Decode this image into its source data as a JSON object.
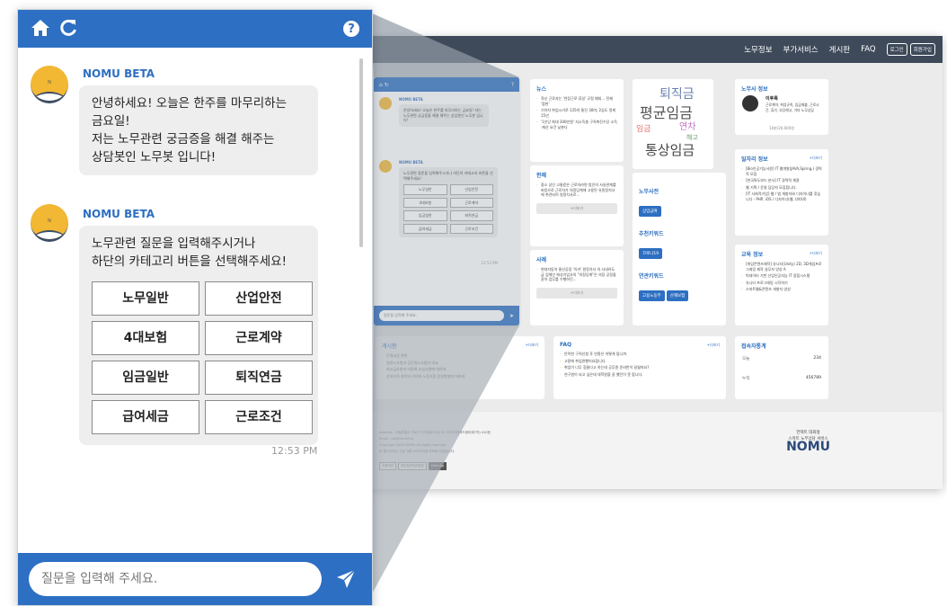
{
  "site": {
    "nav": [
      "노무정보",
      "부가서비스",
      "게시판",
      "FAQ"
    ],
    "login_btn": "로그인",
    "signup_btn": "회원가입",
    "news": {
      "title": "뉴스",
      "items": [
        "육신 근로자는 '연장근로·휴일' 규정 예외... 전제 '합헌'",
        "기아차 취업시기로 135억 통진 30여, 2심도 정계 15년",
        "'1인당 최대 300만원' 지소득층 구직촉진수당 소득·재산 요건 낮춘다"
      ]
    },
    "cases": {
      "title": "판례",
      "items": [
        "중소 상인 고통받은 근로자라면 법인의 사실관계를 바탕으로 근로자가 의정당계에 고용된 유원정치사에 취견되어 원정치사로..."
      ],
      "more": "+더보기"
    },
    "examples": {
      "title": "사례",
      "items": [
        "현대자동차 울산공장 '이카' 원정치서 의 사내하도급 업체인 애성기업사의 \"의정당계\"은 의장 공정을 같아 업무를 수행하던..."
      ],
      "more": "+더보기"
    },
    "wordcloud": [
      "퇴직금",
      "평균임금",
      "통상임금",
      "연차",
      "임금",
      "해고"
    ],
    "dictionary": {
      "title": "노무사전",
      "tag": "상임금여",
      "keywords_title": "추천키워드",
      "keyword": "코로나19",
      "related_title": "연관키워드",
      "related": [
        "고용노동부",
        "산재보험"
      ]
    },
    "profile": {
      "title": "노무사 정보",
      "name": "이후록",
      "desc": "근로계약, 취업규칙, 임금체불, 근로시간, 휴가, 부당해고, 기타 노무상담",
      "fee": "10분/20,000원"
    },
    "jobs": {
      "title": "일자리 정보",
      "more": "+더보기",
      "items": [
        "[Bio인공기능사원] IT 웹개발(JAVA,Spring,) 경력직 모집",
        "[한국특도보드 분사] IT 경력직 채용",
        "웹 기획 / 운영 담당자 모집합니다.",
        "[IT 사회적기업] 웹 / 앱 개발자와 디자이너를 찾습니다 - PHP, iOS / 디자이너(웹, UX/UI)"
      ]
    },
    "edu": {
      "title": "교육 정보",
      "more": "+더보기",
      "items": [
        "[게임콘텐츠제작] 유니티(Unity) 2D, 3D게임프로그래밍 제작 실무자 양성 A",
        "빅데이터 기반 산업인공지능 IT 융합시스템",
        "유니티 프로그래밍 시작하기",
        "스마트웹&콘텐츠 개발자 양성"
      ]
    },
    "board": {
      "title": "게시판",
      "more": "+더보기",
      "items": [
        "단체교섭 관련",
        "일반노조법과 공무원노조법의 비교",
        "비교급사항과 비용화 교섭사항에 대하여",
        "산하조직 설치와 의의와 노동조합 운영방향에 대하여"
      ]
    },
    "faq": {
      "title": "FAQ",
      "more": "+더보기",
      "items": [
        "안락한 구직신청 후 만종은 어떻게 됩니까.",
        "고용에 취업관했어요합니다.",
        "취업이 너무 힘들다고 하는데 공무원 준비반이 달될까요?",
        "연구원이 되고 싶은데 대학원을 갈 했던이 못 합니다."
      ]
    },
    "visitors": {
      "title": "접속자통계",
      "today_label": "오늘",
      "today": "234",
      "total_label": "누적",
      "total": "456789"
    },
    "footer": {
      "lines": [
        "Address : 서울특별시 구로구 디지털로33길 55 (이앤씨벤처드림타워7차) 410호",
        "Email : biz@ctcnet.kr",
        "Copyright 2020 NOMU All rights reserved",
        "본 웹사이트는 구글 크롬 브라우저에 최적화 되었습니다."
      ],
      "btns": [
        "이용약관",
        "개인정보처리방침",
        "Sitemap"
      ],
      "company": "언택트 대화형",
      "service": "스마트 노무상담 서비스",
      "logo": "NOMU"
    }
  },
  "mini_chat": {
    "bot_name": "NOMU BETA",
    "msg1": "안녕하세요! 오늘은 한주를 마무리하는 금요일! 저는 노무관련 궁금증을 해결 해주는 상담봇인 노무봇 입니다!",
    "msg2": "노무관련 질문을 입력해주시거나 하단의 카테고리 버튼을 선택해주세요!",
    "time": "12:53 PM",
    "placeholder": "질문을 입력해 주세요."
  },
  "chat": {
    "bot_name": "NOMU BETA",
    "avatar_letter": "N",
    "msg1_lines": [
      "안녕하세요! 오늘은 한주를 마무리하는",
      "금요일!",
      "저는 노무관련 궁금증을 해결 해주는",
      "상담봇인 노무봇 입니다!"
    ],
    "msg2_lines": [
      "노무관련 질문을 입력해주시거나",
      "하단의 카테고리 버튼을 선택해주세요!"
    ],
    "categories": [
      "노무일반",
      "산업안전",
      "4대보험",
      "근로계약",
      "임금일반",
      "퇴직연금",
      "급여세금",
      "근로조건"
    ],
    "time": "12:53 PM",
    "input_placeholder": "질문을 입력해 주세요."
  },
  "colors": {
    "primary": "#2d6fc2",
    "avatar": "#f2b733",
    "bubble": "#eeeeee",
    "nav": "#3e4a5a"
  },
  "icons": [
    "home-icon",
    "refresh-icon",
    "help-icon",
    "send-icon"
  ]
}
